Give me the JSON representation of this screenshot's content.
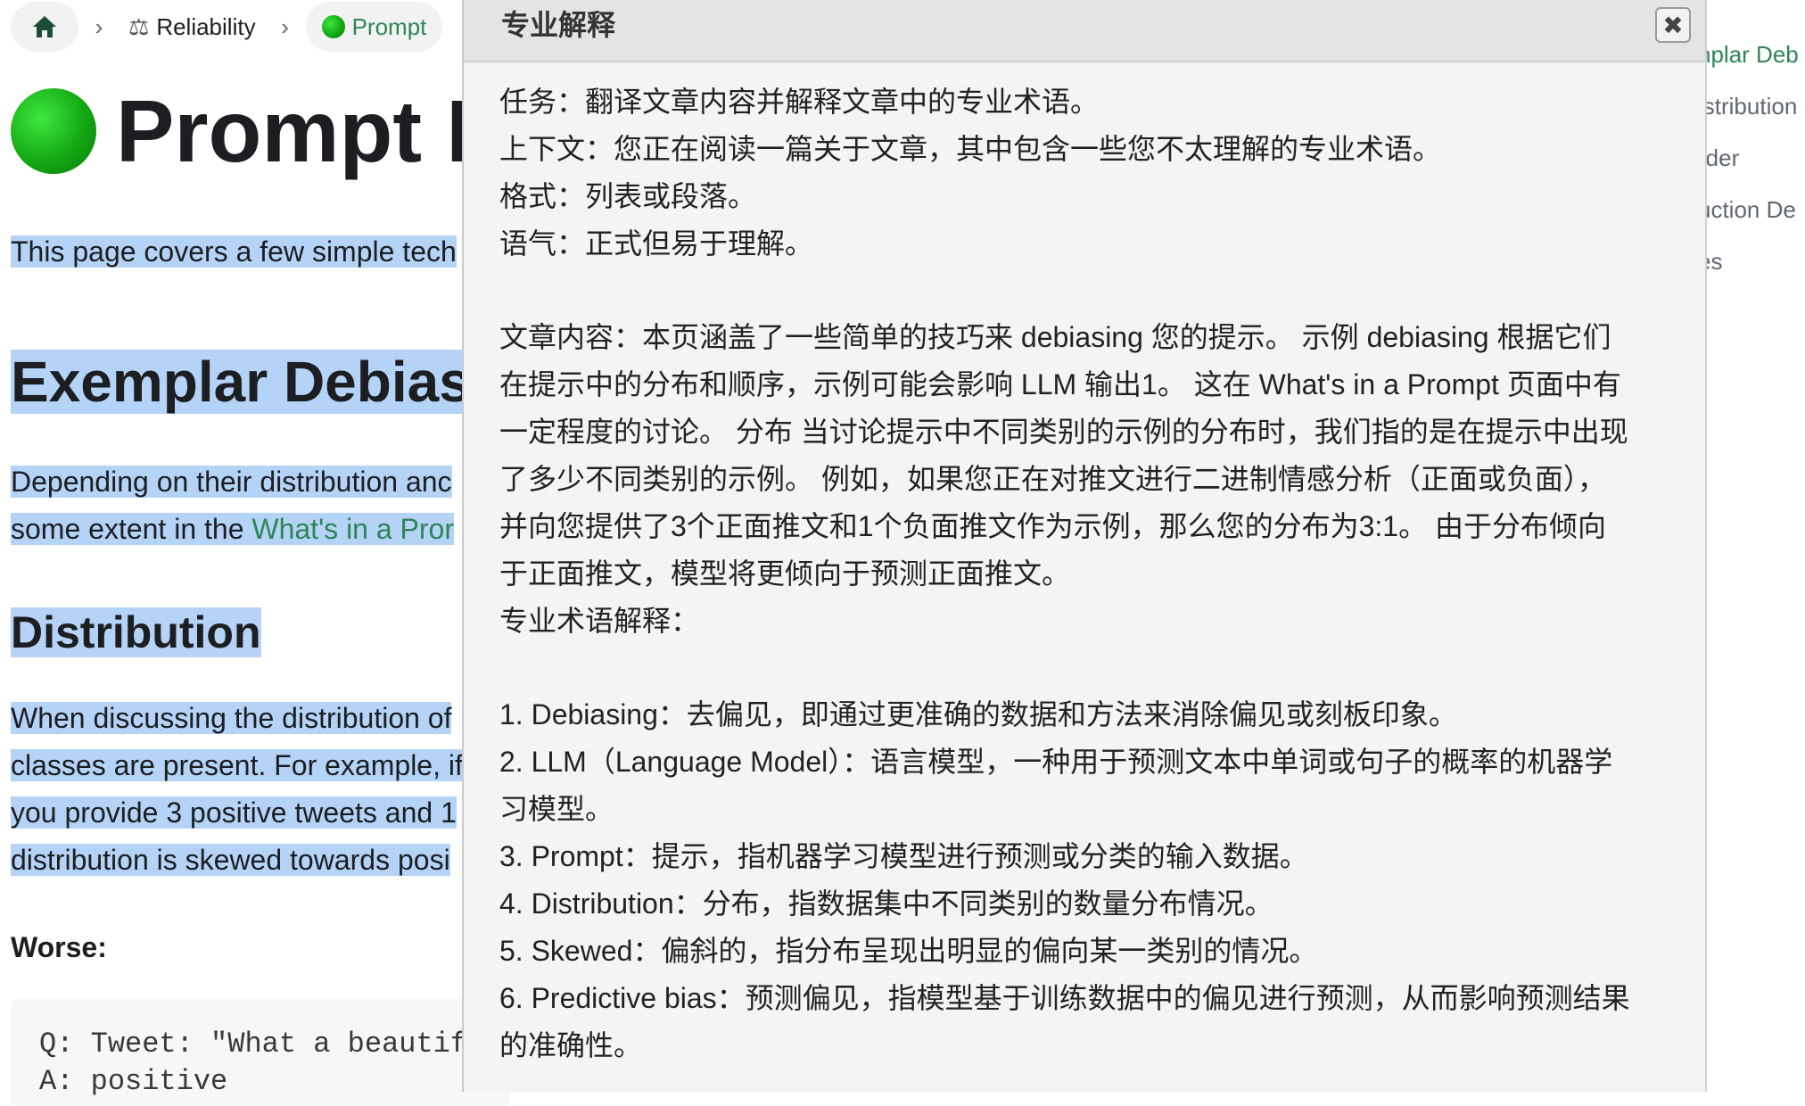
{
  "breadcrumbs": {
    "home_icon": "home-icon",
    "separator": "›",
    "items": [
      {
        "icon": "scale-icon",
        "icon_glyph": "⚖",
        "label": "Reliability"
      },
      {
        "icon": "green-circle-icon",
        "label": "Prompt"
      }
    ]
  },
  "doc": {
    "title": "Prompt D",
    "intro": "This page covers a few simple tech",
    "h2": "Exemplar Debiasi",
    "para1_line1": "Depending on their distribution anc",
    "para1_line2_text": "some extent in the ",
    "para1_line2_link": "What's in a Pror",
    "h3": "Distribution",
    "para2_lines": [
      "When discussing the distribution of",
      "classes are present. For example, if",
      "you provide 3 positive tweets and 1",
      "distribution is skewed towards posi"
    ],
    "worse_label": "Worse:",
    "code_lines": [
      "Q: Tweet: \"What a beautifu",
      "A: positive"
    ]
  },
  "toc": {
    "items": [
      {
        "label": "nplar Deb",
        "active": true
      },
      {
        "label": "istribution",
        "active": false
      },
      {
        "label": "rder",
        "active": false
      },
      {
        "label": "uction De",
        "active": false
      },
      {
        "label": "es",
        "active": false
      }
    ]
  },
  "panel": {
    "title": "专业解释",
    "close_icon": "close-icon",
    "close_glyph": "✖",
    "header_lines": [
      "任务：翻译文章内容并解释文章中的专业术语。",
      "上下文：您正在阅读一篇关于文章，其中包含一些您不太理解的专业术语。",
      "格式：列表或段落。",
      "语气：正式但易于理解。"
    ],
    "article_lines": [
      "文章内容：本页涵盖了一些简单的技巧来 debiasing 您的提示。 示例 debiasing 根据它们",
      "在提示中的分布和顺序，示例可能会影响 LLM 输出1。 这在 What's in a Prompt 页面中有",
      "一定程度的讨论。 分布 当讨论提示中不同类别的示例的分布时，我们指的是在提示中出现",
      "了多少不同类别的示例。 例如，如果您正在对推文进行二进制情感分析（正面或负面），",
      "并向您提供了3个正面推文和1个负面推文作为示例，那么您的分布为3:1。 由于分布倾向",
      "于正面推文，模型将更倾向于预测正面推文。"
    ],
    "terms_heading": "专业术语解释：",
    "term_lines": [
      "1. Debiasing：去偏见，即通过更准确的数据和方法来消除偏见或刻板印象。",
      "2. LLM（Language Model）：语言模型，一种用于预测文本中单词或句子的概率的机器学",
      "习模型。",
      "3. Prompt：提示，指机器学习模型进行预测或分类的输入数据。",
      "4. Distribution：分布，指数据集中不同类别的数量分布情况。",
      "5. Skewed：偏斜的，指分布呈现出明显的偏向某一类别的情况。",
      "6. Predictive bias：预测偏见，指模型基于训练数据中的偏见进行预测，从而影响预测结果",
      "的准确性。"
    ]
  }
}
